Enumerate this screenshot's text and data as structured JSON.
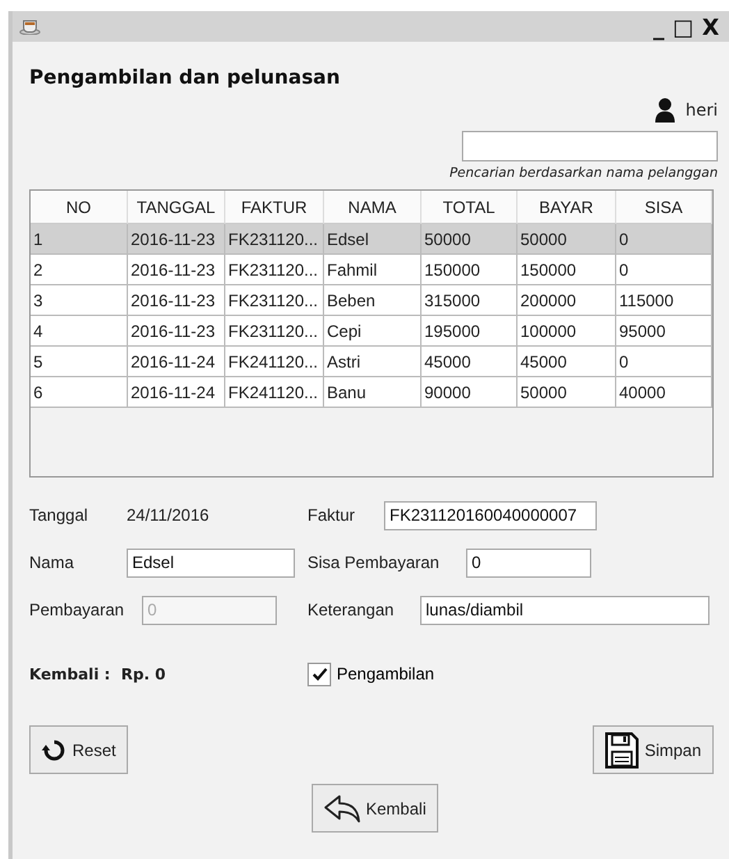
{
  "window": {
    "title_buttons": [
      "_",
      "□",
      "X"
    ]
  },
  "heading": "Pengambilan dan pelunasan",
  "user": {
    "name": "heri"
  },
  "search": {
    "hint": "Pencarian berdasarkan nama pelanggan"
  },
  "table": {
    "columns": [
      "NO",
      "TANGGAL",
      "FAKTUR",
      "NAMA",
      "TOTAL",
      "BAYAR",
      "SISA"
    ],
    "rows": [
      {
        "selected": true,
        "cells": [
          "1",
          "2016-11-23",
          "FK231120...",
          "Edsel",
          "50000",
          "50000",
          "0"
        ]
      },
      {
        "selected": false,
        "cells": [
          "2",
          "2016-11-23",
          "FK231120...",
          "Fahmil",
          "150000",
          "150000",
          "0"
        ]
      },
      {
        "selected": false,
        "cells": [
          "3",
          "2016-11-23",
          "FK231120...",
          "Beben",
          "315000",
          "200000",
          "115000"
        ]
      },
      {
        "selected": false,
        "cells": [
          "4",
          "2016-11-23",
          "FK231120...",
          "Cepi",
          "195000",
          "100000",
          "95000"
        ]
      },
      {
        "selected": false,
        "cells": [
          "5",
          "2016-11-24",
          "FK241120...",
          "Astri",
          "45000",
          "45000",
          "0"
        ]
      },
      {
        "selected": false,
        "cells": [
          "6",
          "2016-11-24",
          "FK241120...",
          "Banu",
          "90000",
          "50000",
          "40000"
        ]
      }
    ]
  },
  "form": {
    "tanggal": {
      "label": "Tanggal",
      "value": "24/11/2016"
    },
    "faktur": {
      "label": "Faktur",
      "value": "FK231120160040000007",
      "disabled": false
    },
    "nama": {
      "label": "Nama",
      "value": "Edsel",
      "disabled": false
    },
    "sisa": {
      "label": "Sisa Pembayaran",
      "value": "0",
      "disabled": false
    },
    "pembayaran": {
      "label": "Pembayaran",
      "value": "0",
      "disabled": true
    },
    "keterangan": {
      "label": "Keterangan",
      "value": "lunas/diambil",
      "disabled": false
    },
    "kembali": "Kembali :  Rp. 0",
    "pengambilan": {
      "label": "Pengambilan",
      "checked": true
    }
  },
  "buttons": {
    "reset": "Reset",
    "simpan": "Simpan",
    "kembali": "Kembali"
  }
}
